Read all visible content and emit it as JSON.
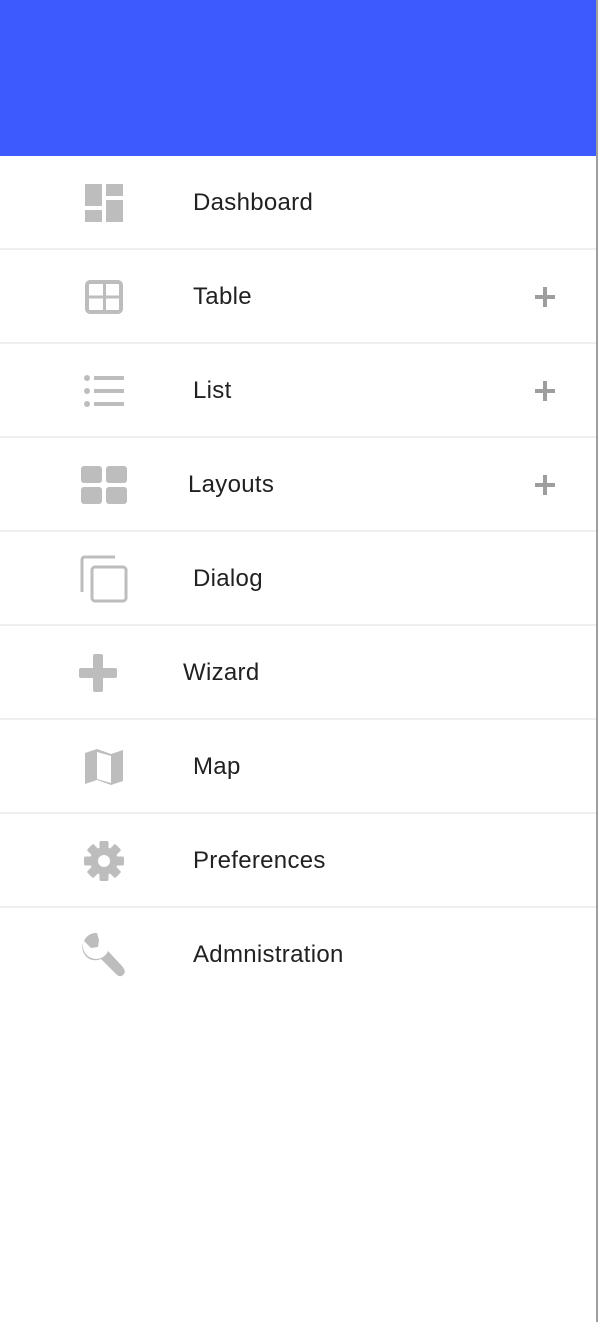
{
  "colors": {
    "header": "#3d5afe",
    "icon": "#bdbdbd",
    "text": "#212121",
    "divider": "#eeeeee",
    "expand_icon": "#9e9e9e"
  },
  "menu": {
    "items": [
      {
        "label": "Dashboard",
        "icon": "dashboard-icon",
        "expandable": false
      },
      {
        "label": "Table",
        "icon": "table-icon",
        "expandable": true
      },
      {
        "label": "List",
        "icon": "list-icon",
        "expandable": true
      },
      {
        "label": "Layouts",
        "icon": "layouts-icon",
        "expandable": true
      },
      {
        "label": "Dialog",
        "icon": "dialog-icon",
        "expandable": false
      },
      {
        "label": "Wizard",
        "icon": "plus-icon",
        "expandable": false
      },
      {
        "label": "Map",
        "icon": "map-icon",
        "expandable": false
      },
      {
        "label": "Preferences",
        "icon": "gear-icon",
        "expandable": false
      },
      {
        "label": "Admnistration",
        "icon": "wrench-icon",
        "expandable": false
      }
    ]
  }
}
